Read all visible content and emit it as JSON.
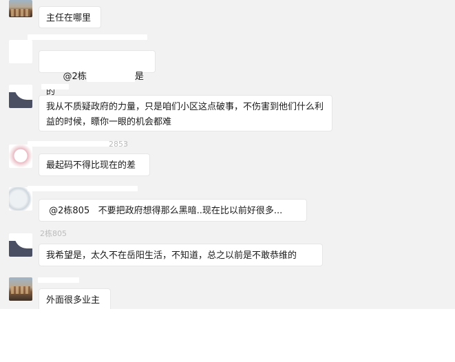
{
  "messages": [
    {
      "sender": "",
      "text": "主任在哪里"
    },
    {
      "sender": "",
      "text": "@2栋805 不要把政府想得那么黑暗..现在比以前好很多..."
    },
    {
      "sender": "",
      "text": "我从不质疑政府的力量，只是咱们小区这点破事，不伤害到他们什么利益的时候，瞟你一眼的机会都难"
    },
    {
      "sender": "",
      "text": "最起码不得比现在的差"
    },
    {
      "sender": "",
      "text": " @2栋805   不要把政府想得那么黑暗..现在比以前好很多..."
    },
    {
      "sender": "2栋805",
      "text": "我希望是，太久不在岳阳生活，不知道，总之以前是不敢恭维的"
    },
    {
      "sender": "",
      "text": "外面很多业主"
    }
  ],
  "partial": {
    "reply_prefix": "@2栋",
    "reply_suffix": "是的",
    "name_fragment_4": "2853"
  }
}
